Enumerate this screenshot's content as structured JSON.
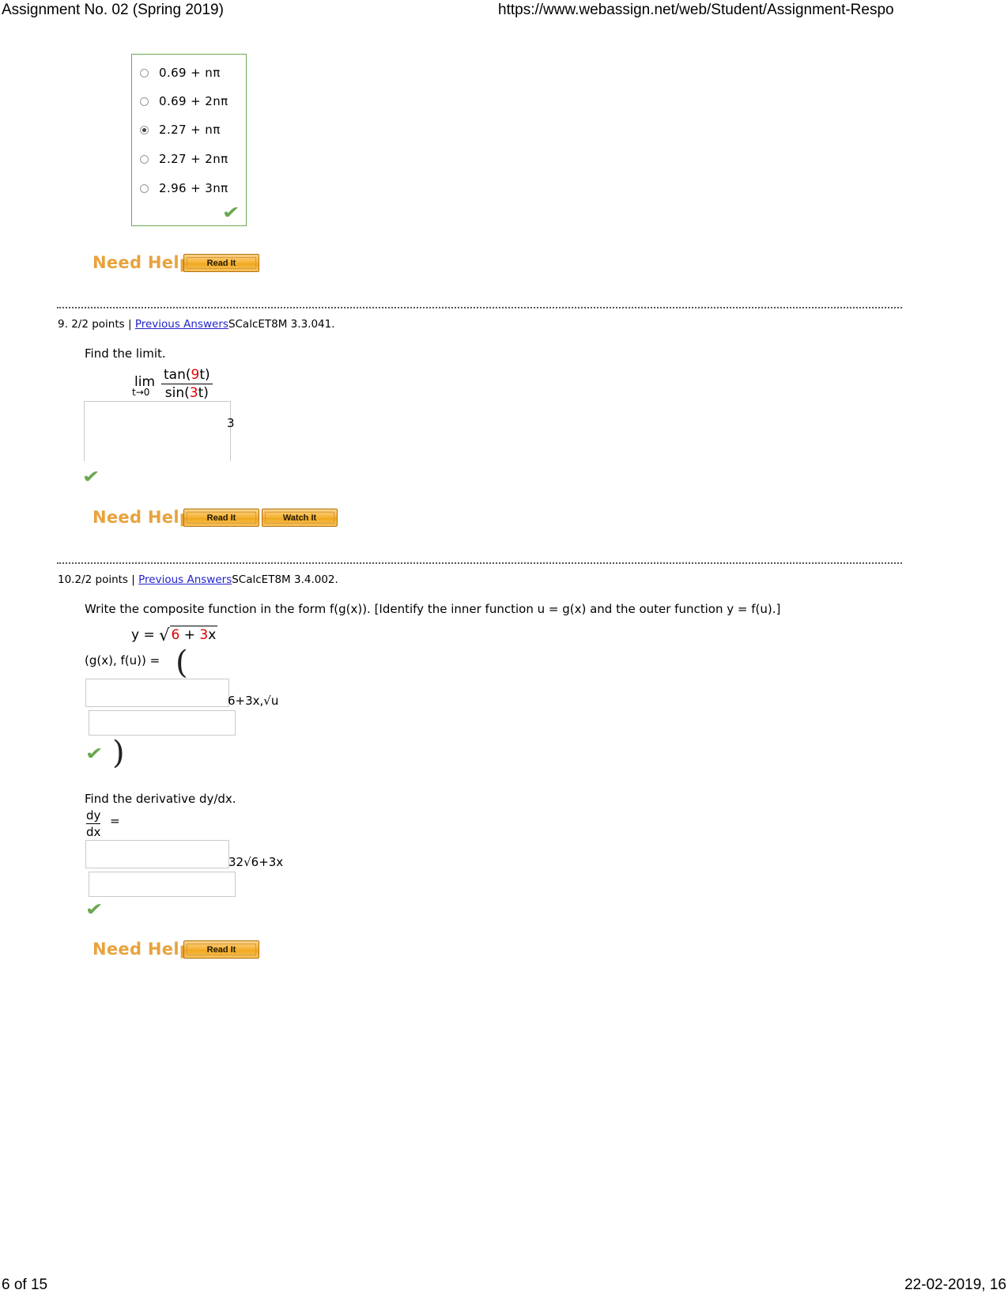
{
  "print_header": {
    "title": "Assignment No. 02 (Spring 2019)",
    "url": "https://www.webassign.net/web/Student/Assignment-Respo"
  },
  "print_footer": {
    "page": "6 of 15",
    "date": "22-02-2019, 16"
  },
  "question_8_tail": {
    "choices": [
      {
        "label": "0.69 + nπ",
        "selected": false
      },
      {
        "label": "0.69 + 2nπ",
        "selected": false
      },
      {
        "label": "2.27 + nπ",
        "selected": true
      },
      {
        "label": "2.27 + 2nπ",
        "selected": false
      },
      {
        "label": "2.96 + 3nπ",
        "selected": false
      }
    ],
    "correct_mark": "✔",
    "need_help_label": "Need Help?",
    "buttons": [
      {
        "label": "Read It"
      }
    ]
  },
  "question_9": {
    "number": "9.",
    "points": "2/2 points",
    "separator": "|",
    "previous_answers": "Previous Answers",
    "code": "SCalcET8M 3.3.041.",
    "prompt": "Find the limit.",
    "limit": {
      "op": "lim",
      "sub": "t→0",
      "numerator_prefix": "tan(",
      "numerator_red": "9",
      "numerator_suffix": "t)",
      "denominator_prefix": "sin(",
      "denominator_red": "3",
      "denominator_suffix": "t)"
    },
    "answer": "3",
    "correct_mark": "✔",
    "need_help_label": "Need Help?",
    "buttons": [
      {
        "label": "Read It"
      },
      {
        "label": "Watch It"
      }
    ]
  },
  "question_10": {
    "number": "10.",
    "points": "2/2 points",
    "separator": "|",
    "previous_answers": "Previous Answers",
    "code": "SCalcET8M 3.4.002.",
    "prompt": "Write the composite function in the form  f(g(x)).   [Identify the inner function   u = g(x)   and the outer function  y = f(u).]",
    "function_def": {
      "lhs": "y =",
      "radicand_red_1": "6",
      "radicand_plus": " + ",
      "radicand_red_2": "3",
      "radicand_x": "x"
    },
    "pair_label": "(g(x), f(u)) =",
    "open_paren": "(",
    "close_paren": ")",
    "answer": "6+3x,√u",
    "correct_mark": "✔",
    "derivative_prompt": "Find the derivative dy/dx.",
    "derivative_lhs_num": "dy",
    "derivative_lhs_den": "dx",
    "derivative_equals": "=",
    "derivative_answer": "32√6+3x",
    "derivative_correct_mark": "✔",
    "need_help_label": "Need Help?",
    "buttons": [
      {
        "label": "Read It"
      }
    ]
  },
  "colors": {
    "link": "#2222CC",
    "red_param": "#DD0000",
    "correct_green": "#6AA84F",
    "need_help_orange": "#E8A33D",
    "box_border_green": "#6AA84F"
  }
}
